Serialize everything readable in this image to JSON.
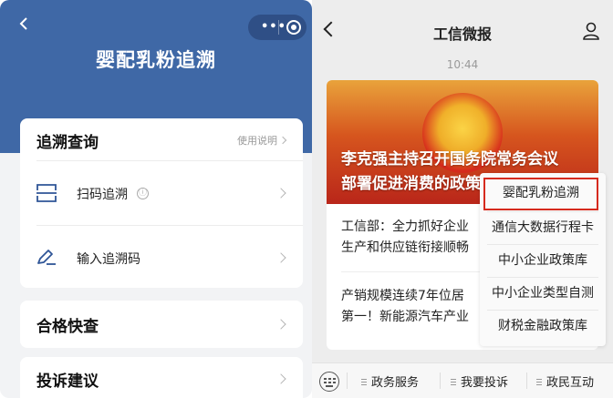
{
  "left_app": {
    "title": "婴配乳粉追溯",
    "trace_section": {
      "title": "追溯查询",
      "help_link": "使用说明",
      "rows": [
        {
          "label": "扫码追溯",
          "icon": "scan-icon",
          "info_icon": "ⓘ"
        },
        {
          "label": "输入追溯码",
          "icon": "pen-icon"
        }
      ]
    },
    "cards": [
      {
        "title": "合格快查"
      },
      {
        "title": "投诉建议"
      }
    ]
  },
  "right_chat": {
    "title": "工信微报",
    "time": "10:44",
    "article": {
      "headline_line1": "李克强主持召开国务院常务会议",
      "headline_line2": "部署促进消费的政策",
      "items": [
        {
          "line1": "工信部：全力抓好企业",
          "line2": "生产和供应链衔接顺畅"
        },
        {
          "line1": "产销规模连续7年位居",
          "line2": "第一！新能源汽车产业"
        }
      ]
    },
    "menu": {
      "items": [
        "婴配乳粉追溯",
        "通信大数据行程卡",
        "中小企业政策库",
        "中小企业类型自测",
        "财税金融政策库"
      ],
      "highlight_color": "#d62a1e"
    },
    "bottom_tabs": [
      "政务服务",
      "我要投诉",
      "政民互动"
    ]
  },
  "colors": {
    "header_blue": "#3f68a6",
    "banner_red": "#b9261a"
  }
}
